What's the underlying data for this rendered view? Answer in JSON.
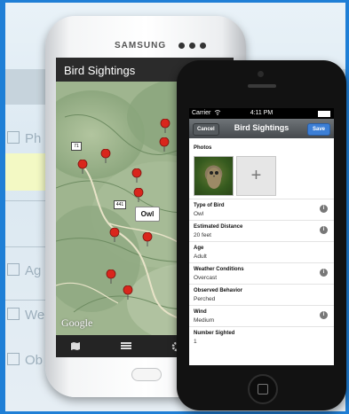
{
  "background": {
    "labels": [
      "Ph",
      "Ag",
      "We",
      "Ob"
    ]
  },
  "samsung": {
    "brand": "SAMSUNG",
    "title": "Bird Sightings",
    "map": {
      "google_logo": "Google",
      "callout": "Owl",
      "road_signs": [
        "71",
        "441"
      ]
    },
    "nav_icons": [
      "map-icon",
      "list-icon",
      "gear-icon"
    ]
  },
  "iphone": {
    "status": {
      "carrier": "Carrier",
      "time": "4:11 PM"
    },
    "nav": {
      "cancel": "Cancel",
      "title": "Bird Sightings",
      "save": "Save"
    },
    "photos_label": "Photos",
    "add_photo_glyph": "+",
    "fields": [
      {
        "label": "Type of Bird",
        "value": "Owl",
        "info": true
      },
      {
        "label": "Estimated Distance",
        "value": "20 feet",
        "info": true
      },
      {
        "label": "Age",
        "value": "Adult",
        "info": false
      },
      {
        "label": "Weather Conditions",
        "value": "Overcast",
        "info": true
      },
      {
        "label": "Observed Behavior",
        "value": "Perched",
        "info": false
      },
      {
        "label": "Wind",
        "value": "Medium",
        "info": true
      },
      {
        "label": "Number Sighted",
        "value": "1",
        "info": false
      }
    ]
  },
  "colors": {
    "frame": "#1f7fd6",
    "pin": "#d9261c",
    "save": "#3c7fd6"
  }
}
